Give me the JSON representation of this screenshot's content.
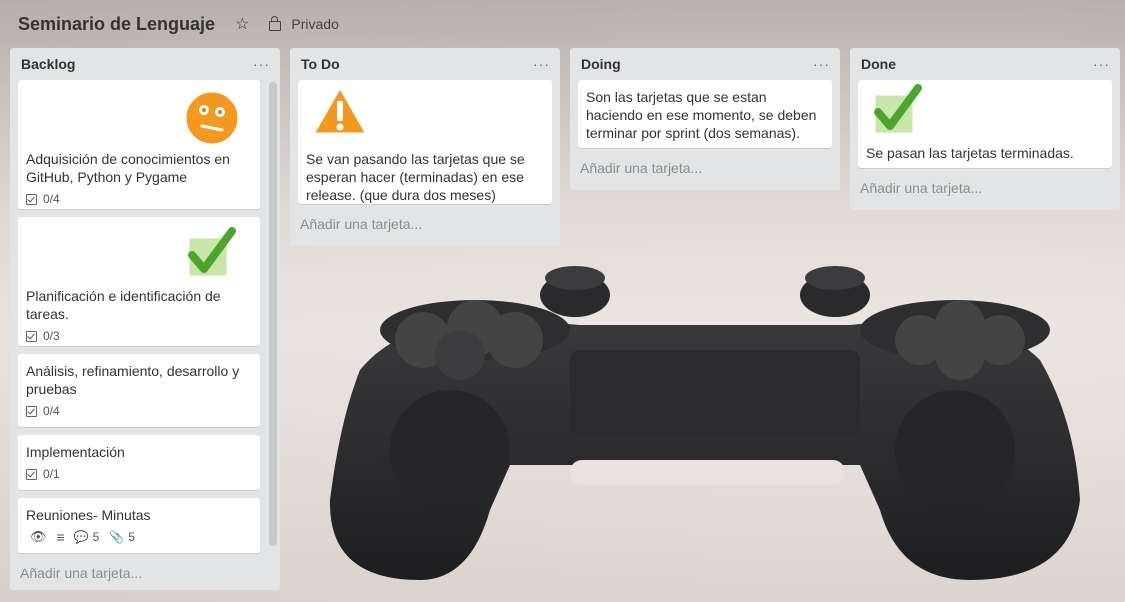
{
  "header": {
    "title": "Seminario de Lenguaje",
    "visibility": "Privado",
    "star_icon": "star-icon",
    "lock_icon": "lock-icon"
  },
  "lists": [
    {
      "title": "Backlog",
      "add_label": "Añadir una tarjeta...",
      "cards": [
        {
          "title": "Adquisición de conocimientos en GitHub, Python y Pygame",
          "checklist": "0/4",
          "cover_icon": "orange-face-icon"
        },
        {
          "title": "Planificación e identificación de tareas.",
          "checklist": "0/3",
          "cover_icon": "green-check-icon"
        },
        {
          "title": "Análisis, refinamiento, desarrollo y pruebas",
          "checklist": "0/4"
        },
        {
          "title": "Implementación",
          "checklist": "0/1"
        },
        {
          "title": "Reuniones- Minutas",
          "comments": "5",
          "attachments": "5"
        }
      ]
    },
    {
      "title": "To Do",
      "add_label": "Añadir una tarjeta...",
      "cards": [
        {
          "title": "Se van pasando las tarjetas que se esperan hacer (terminadas) en ese release. (que dura dos meses)",
          "cover_icon": "warning-icon"
        }
      ]
    },
    {
      "title": "Doing",
      "add_label": "Añadir una tarjeta...",
      "cards": [
        {
          "title": "Son las tarjetas que se estan haciendo en ese momento, se deben terminar por sprint (dos semanas)."
        }
      ]
    },
    {
      "title": "Done",
      "add_label": "Añadir una tarjeta...",
      "cards": [
        {
          "title": "Se pasan las tarjetas terminadas.",
          "cover_icon": "green-check-icon"
        }
      ]
    }
  ],
  "menu_label": "···"
}
